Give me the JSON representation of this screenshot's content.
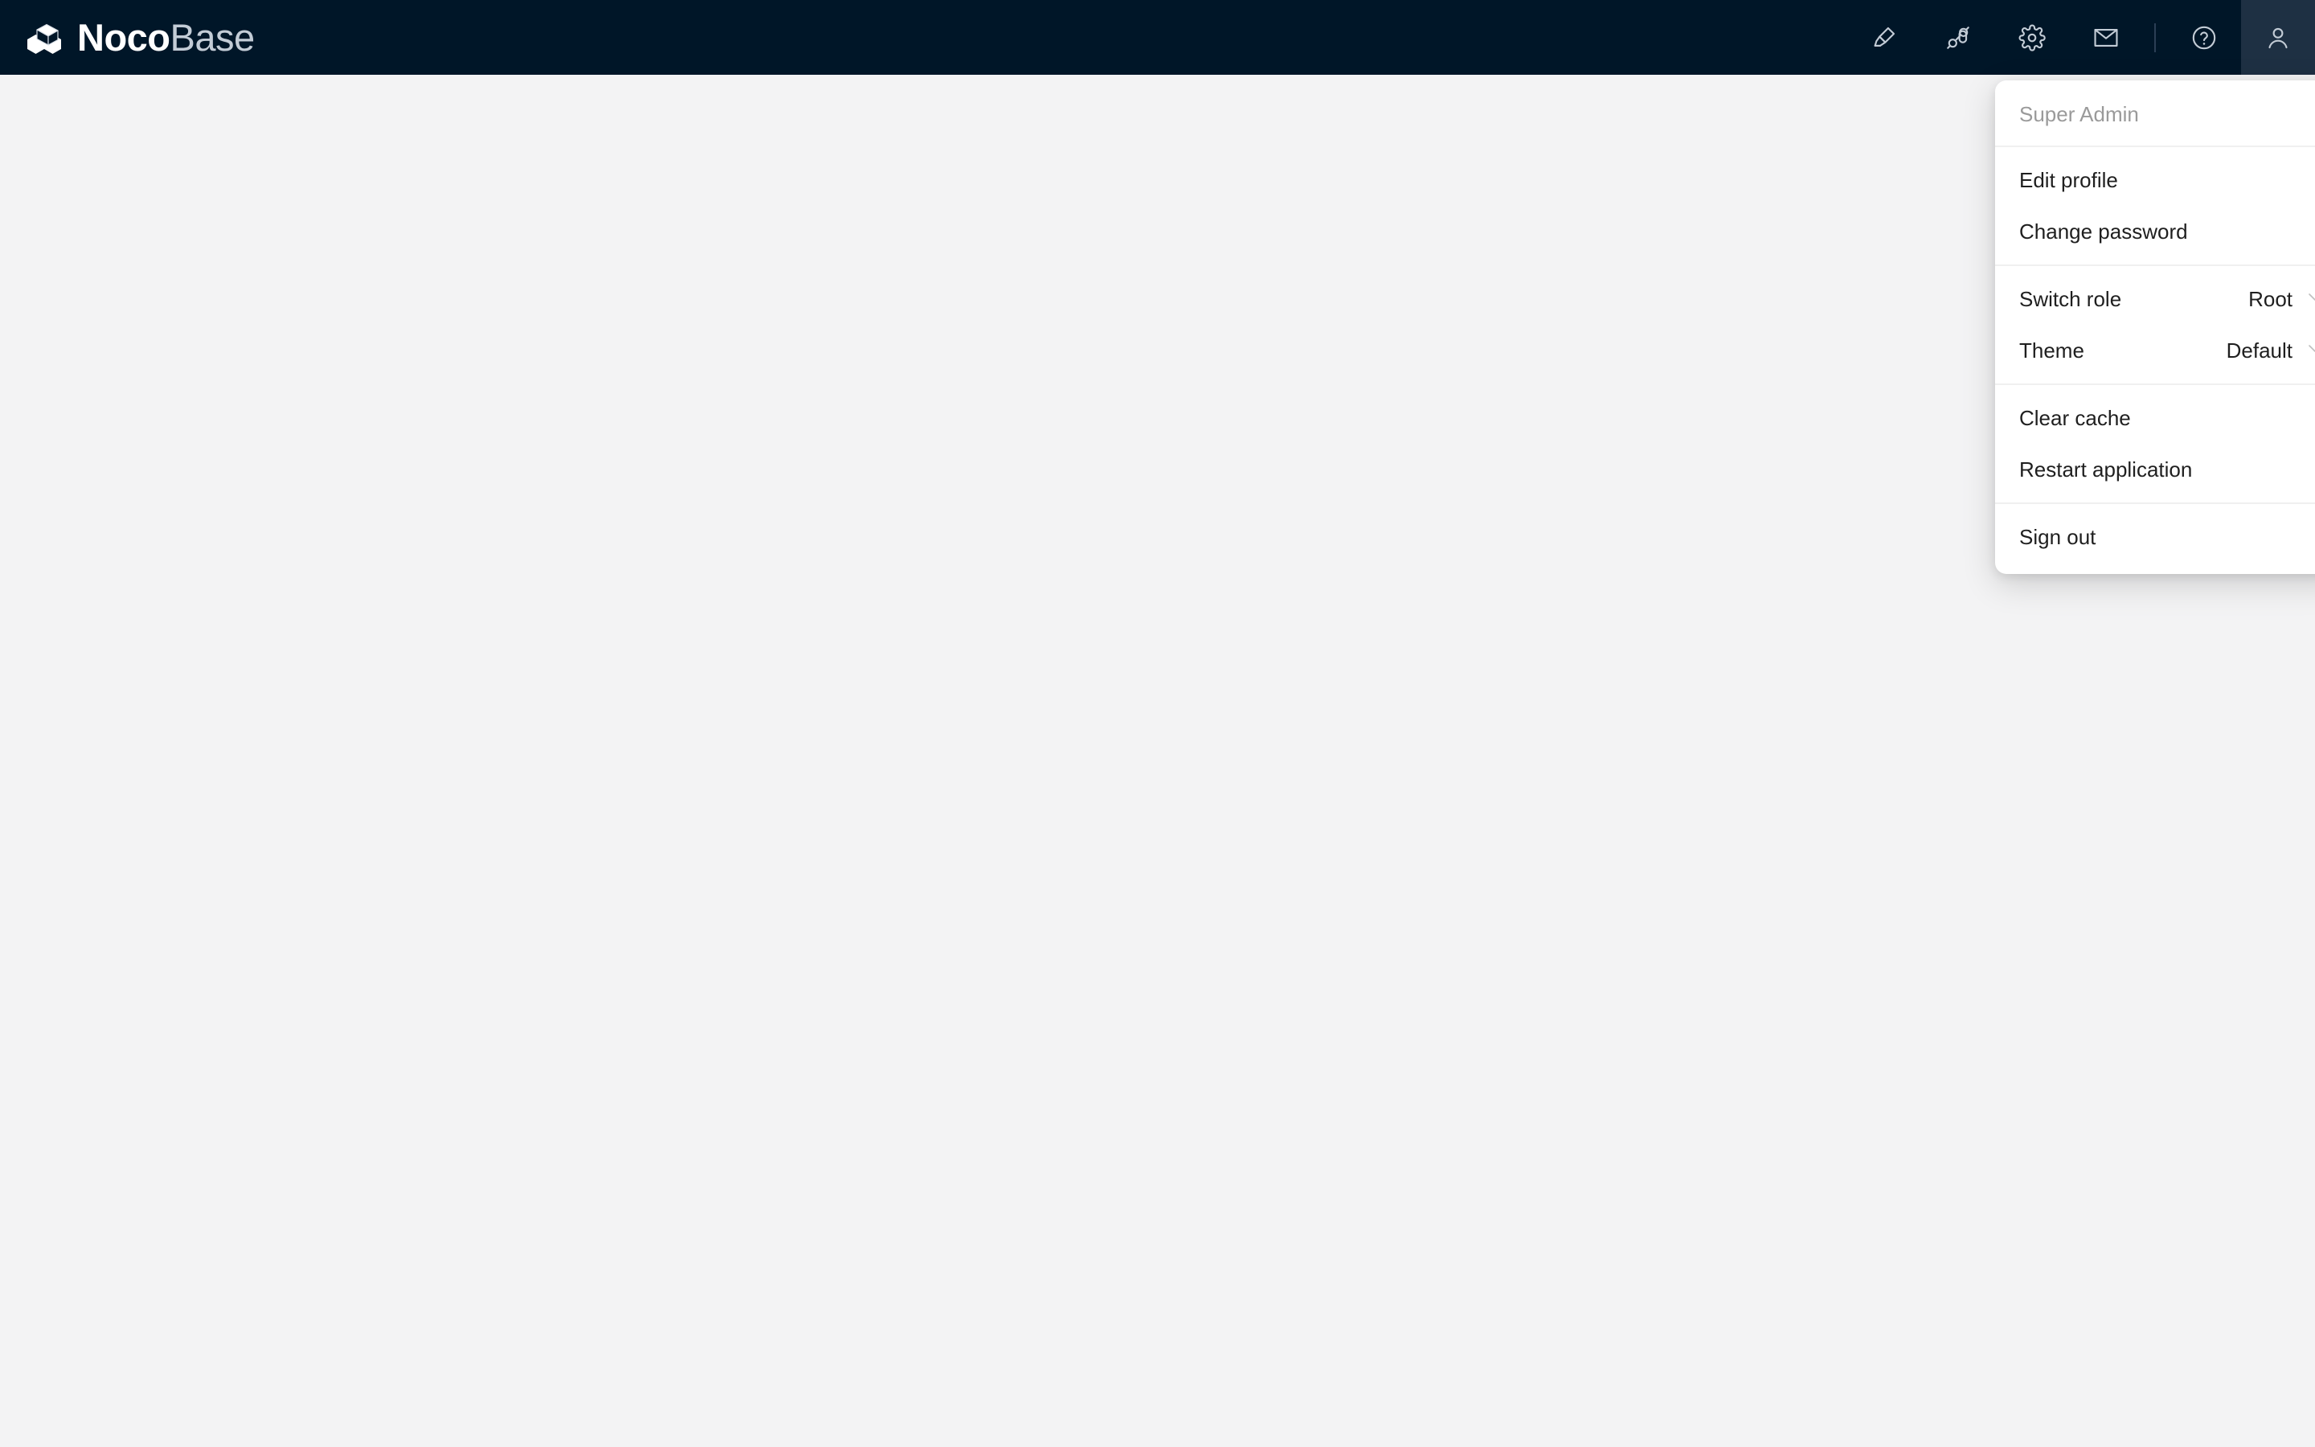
{
  "app": {
    "logo_icon": "nocobase-cube-logo-icon",
    "name_strong": "Noco",
    "name_light": "Base"
  },
  "header": {
    "actions": [
      {
        "name": "highlighter-icon",
        "title": "UI editor"
      },
      {
        "name": "plugin-icon",
        "title": "Plugin manager"
      },
      {
        "name": "gear-icon",
        "title": "Settings"
      },
      {
        "name": "mail-icon",
        "title": "Notifications"
      },
      {
        "name": "help-circle-icon",
        "title": "Help"
      },
      {
        "name": "user-avatar-icon",
        "title": "Current user"
      }
    ]
  },
  "user_menu": {
    "username": "Super Admin",
    "edit_profile": "Edit profile",
    "change_password": "Change password",
    "switch_role_label": "Switch role",
    "switch_role_value": "Root",
    "theme_label": "Theme",
    "theme_value": "Default",
    "clear_cache": "Clear cache",
    "restart_application": "Restart application",
    "sign_out": "Sign out"
  },
  "colors": {
    "header_bg": "#001628",
    "header_active": "#1e3043",
    "page_bg": "#f3f3f4",
    "menu_bg": "#ffffff",
    "muted_text": "#9a9a9a",
    "separator": "#f0f0f0"
  }
}
